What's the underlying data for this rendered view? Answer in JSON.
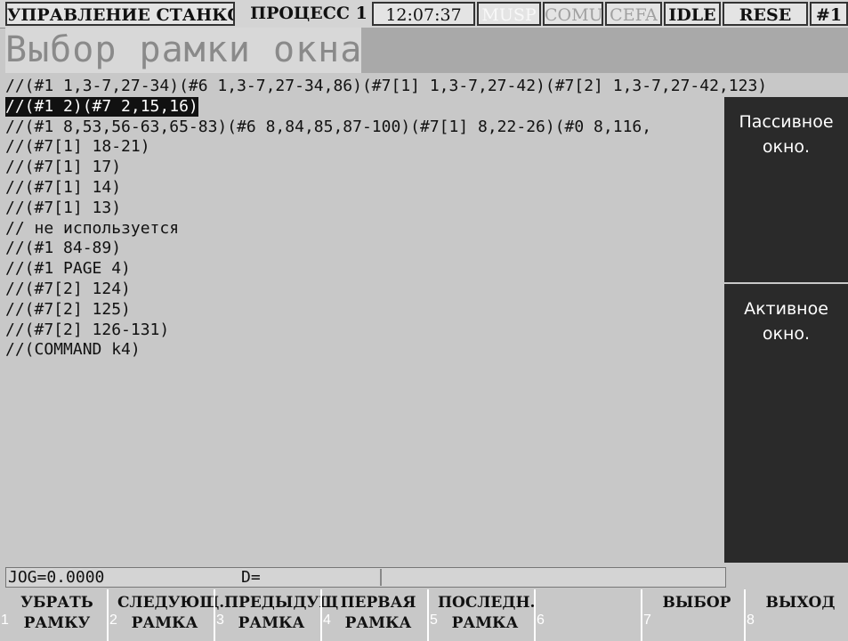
{
  "top_bar": {
    "title": "УПРАВЛЕНИЕ СТАНКОМ",
    "process": "ПРОЦЕСС 1",
    "time": "12:07:37",
    "musp": "MUSP",
    "comu": "COMU",
    "cefa": "CEFA",
    "idle": "IDLE",
    "rese": "RESE",
    "channel": "#1"
  },
  "page_title": "Выбор рамки окна.",
  "lines": [
    "//(#1 1,3-7,27-34)(#6 1,3-7,27-34,86)(#7[1] 1,3-7,27-42)(#7[2] 1,3-7,27-42,123)",
    "//(#1 2)(#7 2,15,16)",
    "//(#1 8,53,56-63,65-83)(#6 8,84,85,87-100)(#7[1] 8,22-26)(#0 8,116,",
    "//(#7[1] 18-21)",
    "//(#7[1] 17)",
    "//(#7[1] 14)",
    "//(#7[1] 13)",
    "// не используется",
    "//(#1 84-89)",
    "//(#1 PAGE 4)",
    "//(#7[2] 124)",
    "//(#7[2] 125)",
    "//(#7[2] 126-131)",
    "//(COMMAND k4)"
  ],
  "selected_line_index": 1,
  "side_panels": {
    "passive": "Пассивное\nокно.",
    "active": "Активное\nокно."
  },
  "status": {
    "jog": "JOG=0.0000",
    "d": "D="
  },
  "softkeys": [
    {
      "num": "1",
      "label": "УБРАТЬ\nРАМКУ"
    },
    {
      "num": "2",
      "label": "СЛЕДУЮЩ.\nРАМКА"
    },
    {
      "num": "3",
      "label": "ПРЕДЫДУЩ\nРАМКА"
    },
    {
      "num": "4",
      "label": "ПЕРВАЯ\nРАМКА"
    },
    {
      "num": "5",
      "label": "ПОСЛЕДН.\nРАМКА"
    },
    {
      "num": "6",
      "label": ""
    },
    {
      "num": "7",
      "label": "ВЫБОР"
    },
    {
      "num": "8",
      "label": "ВЫХОД"
    }
  ]
}
